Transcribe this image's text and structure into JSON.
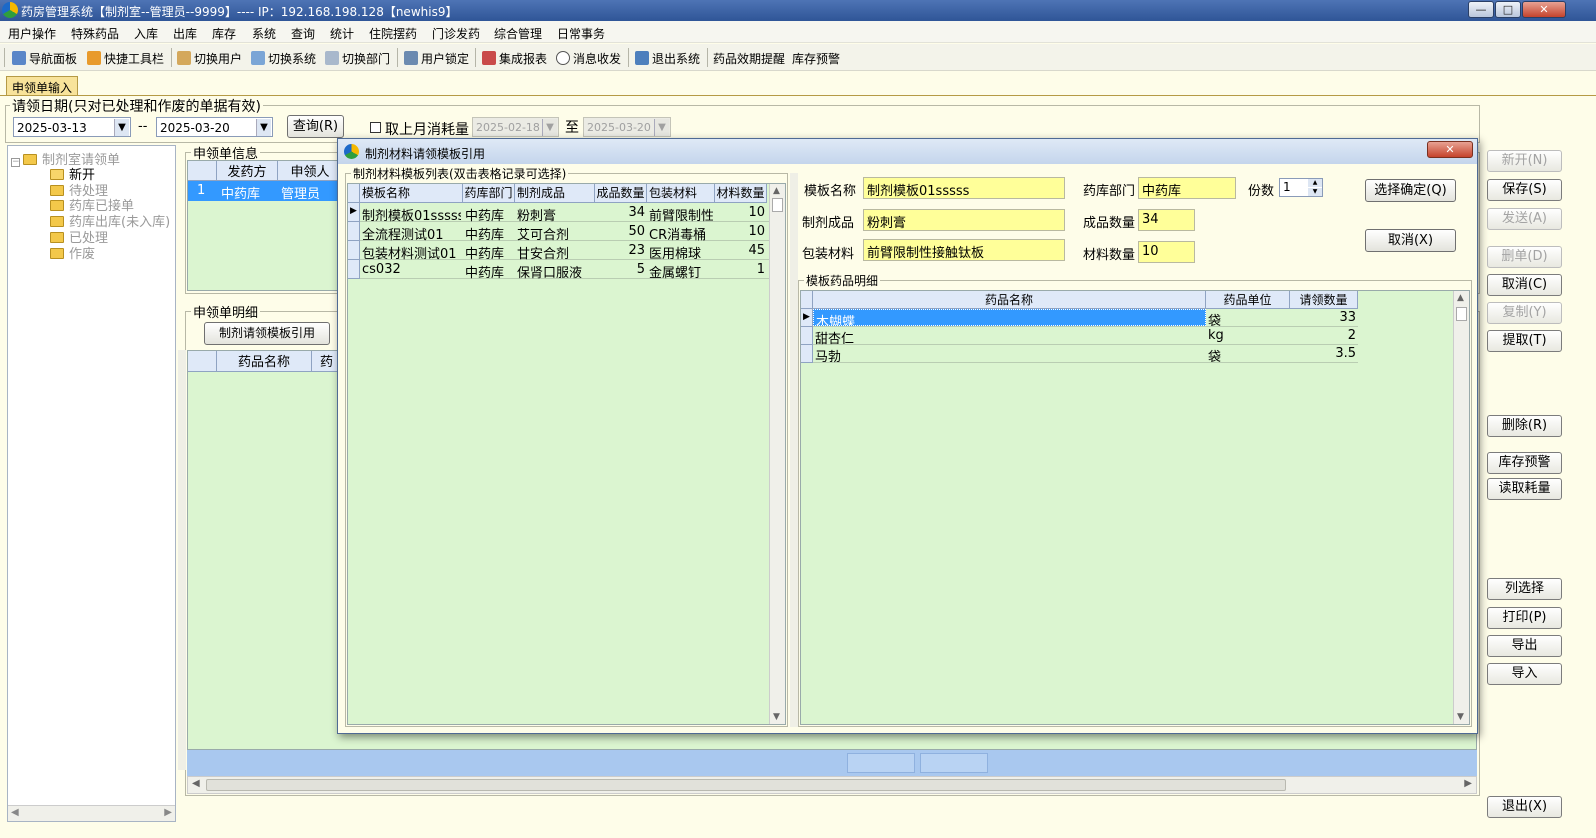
{
  "window": {
    "title": "药房管理系统【制剂室--管理员--9999】---- IP：192.168.198.128【newhis9】",
    "min_label": "—",
    "max_label": "□",
    "close_label": "✕"
  },
  "menu": [
    "用户操作",
    "特殊药品",
    "入库",
    "出库",
    "库存",
    "系统",
    "查询",
    "统计",
    "住院摆药",
    "门诊发药",
    "综合管理",
    "日常事务"
  ],
  "toolbar": [
    "导航面板",
    "快捷工具栏",
    "切换用户",
    "切换系统",
    "切换部门",
    "用户锁定",
    "集成报表",
    "消息收发",
    "退出系统",
    "药品效期提醒",
    "库存预警"
  ],
  "tab": "申领单输入",
  "filter": {
    "legend": "请领日期(只对已处理和作废的单据有效)",
    "date_from": "2025-03-13",
    "dash": "--",
    "date_to": "2025-03-20",
    "query_btn": "查询(R)",
    "checkbox_label": "取上月消耗量",
    "last_from": "2025-02-18",
    "to_label": "至",
    "last_to": "2025-03-20"
  },
  "tree": {
    "root": "制剂室请领单",
    "items": [
      "新开",
      "待处理",
      "药库已接单",
      "药库出库(未入库)",
      "已处理",
      "作废"
    ]
  },
  "info": {
    "legend": "申领单信息",
    "headers": [
      "发药方",
      "申领人"
    ],
    "row": {
      "no": "1",
      "from": "中药库",
      "person": "管理员"
    }
  },
  "detail": {
    "legend": "申领单明细",
    "template_btn": "制剂请领模板引用",
    "headers": [
      "药品名称",
      "药"
    ]
  },
  "right_buttons": [
    "新开(N)",
    "保存(S)",
    "发送(A)",
    "删单(D)",
    "取消(C)",
    "复制(Y)",
    "提取(T)",
    "删除(R)",
    "库存预警",
    "读取耗量",
    "列选择",
    "打印(P)",
    "导出",
    "导入",
    "退出(X)"
  ],
  "dialog": {
    "title": "制剂材料请领模板引用",
    "close": "✕",
    "list_legend": "制剂材料模板列表(双击表格记录可选择)",
    "list_headers": [
      "模板名称",
      "药库部门",
      "制剂成品",
      "成品数量",
      "包装材料",
      "材料数量"
    ],
    "list_rows": [
      [
        "制剂模板01sssss",
        "中药库",
        "粉刺膏",
        "34",
        "前臂限制性",
        "10"
      ],
      [
        "全流程测试01",
        "中药库",
        "艾可合剂",
        "50",
        "CR消毒桶",
        "10"
      ],
      [
        "包装材料测试01",
        "中药库",
        "甘安合剂",
        "23",
        "医用棉球",
        "45"
      ],
      [
        "cs032",
        "中药库",
        "保肾口服液",
        "5",
        "金属螺钉",
        "1"
      ]
    ],
    "form": {
      "name_label": "模板名称",
      "name_value": "制剂模板01sssss",
      "dept_label": "药库部门",
      "dept_value": "中药库",
      "copies_label": "份数",
      "copies_value": "1",
      "product_label": "制剂成品",
      "product_value": "粉刺膏",
      "qty_label": "成品数量",
      "qty_value": "34",
      "pack_label": "包装材料",
      "pack_value": "前臂限制性接触钛板",
      "mat_label": "材料数量",
      "mat_value": "10",
      "confirm_btn": "选择确定(Q)",
      "cancel_btn": "取消(X)"
    },
    "detail_legend": "模板药品明细",
    "detail_headers": [
      "药品名称",
      "药品单位",
      "请领数量"
    ],
    "detail_rows": [
      [
        "木蝴蝶",
        "袋",
        "33"
      ],
      [
        "甜杏仁",
        "kg",
        "2"
      ],
      [
        "马勃",
        "袋",
        "3.5"
      ]
    ]
  }
}
